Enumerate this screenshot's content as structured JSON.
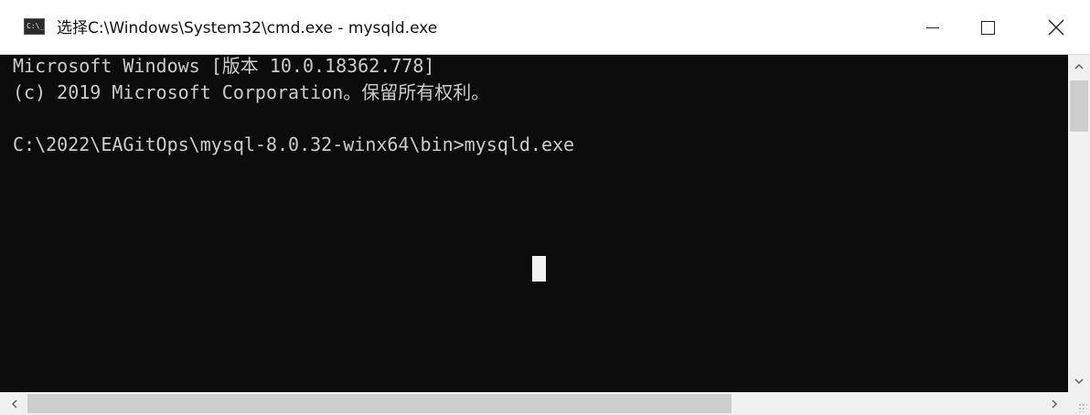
{
  "window": {
    "title": "选择C:\\Windows\\System32\\cmd.exe - mysqld.exe",
    "icon": "cmd-icon",
    "icon_text": "C:\\_",
    "controls": {
      "minimize": "—",
      "maximize": "☐",
      "close": "✕"
    }
  },
  "console": {
    "lines": [
      "Microsoft Windows [版本 10.0.18362.778]",
      "(c) 2019 Microsoft Corporation。保留所有权利。",
      "C:\\2022\\EAGitOps\\mysql-8.0.32-winx64\\bin>mysqld.exe"
    ],
    "background": "#0c0c0c",
    "foreground": "#cccccc"
  },
  "scrollbars": {
    "vertical": {
      "up": "^",
      "down": "v"
    },
    "horizontal": {
      "left": "<",
      "right": ">"
    }
  }
}
